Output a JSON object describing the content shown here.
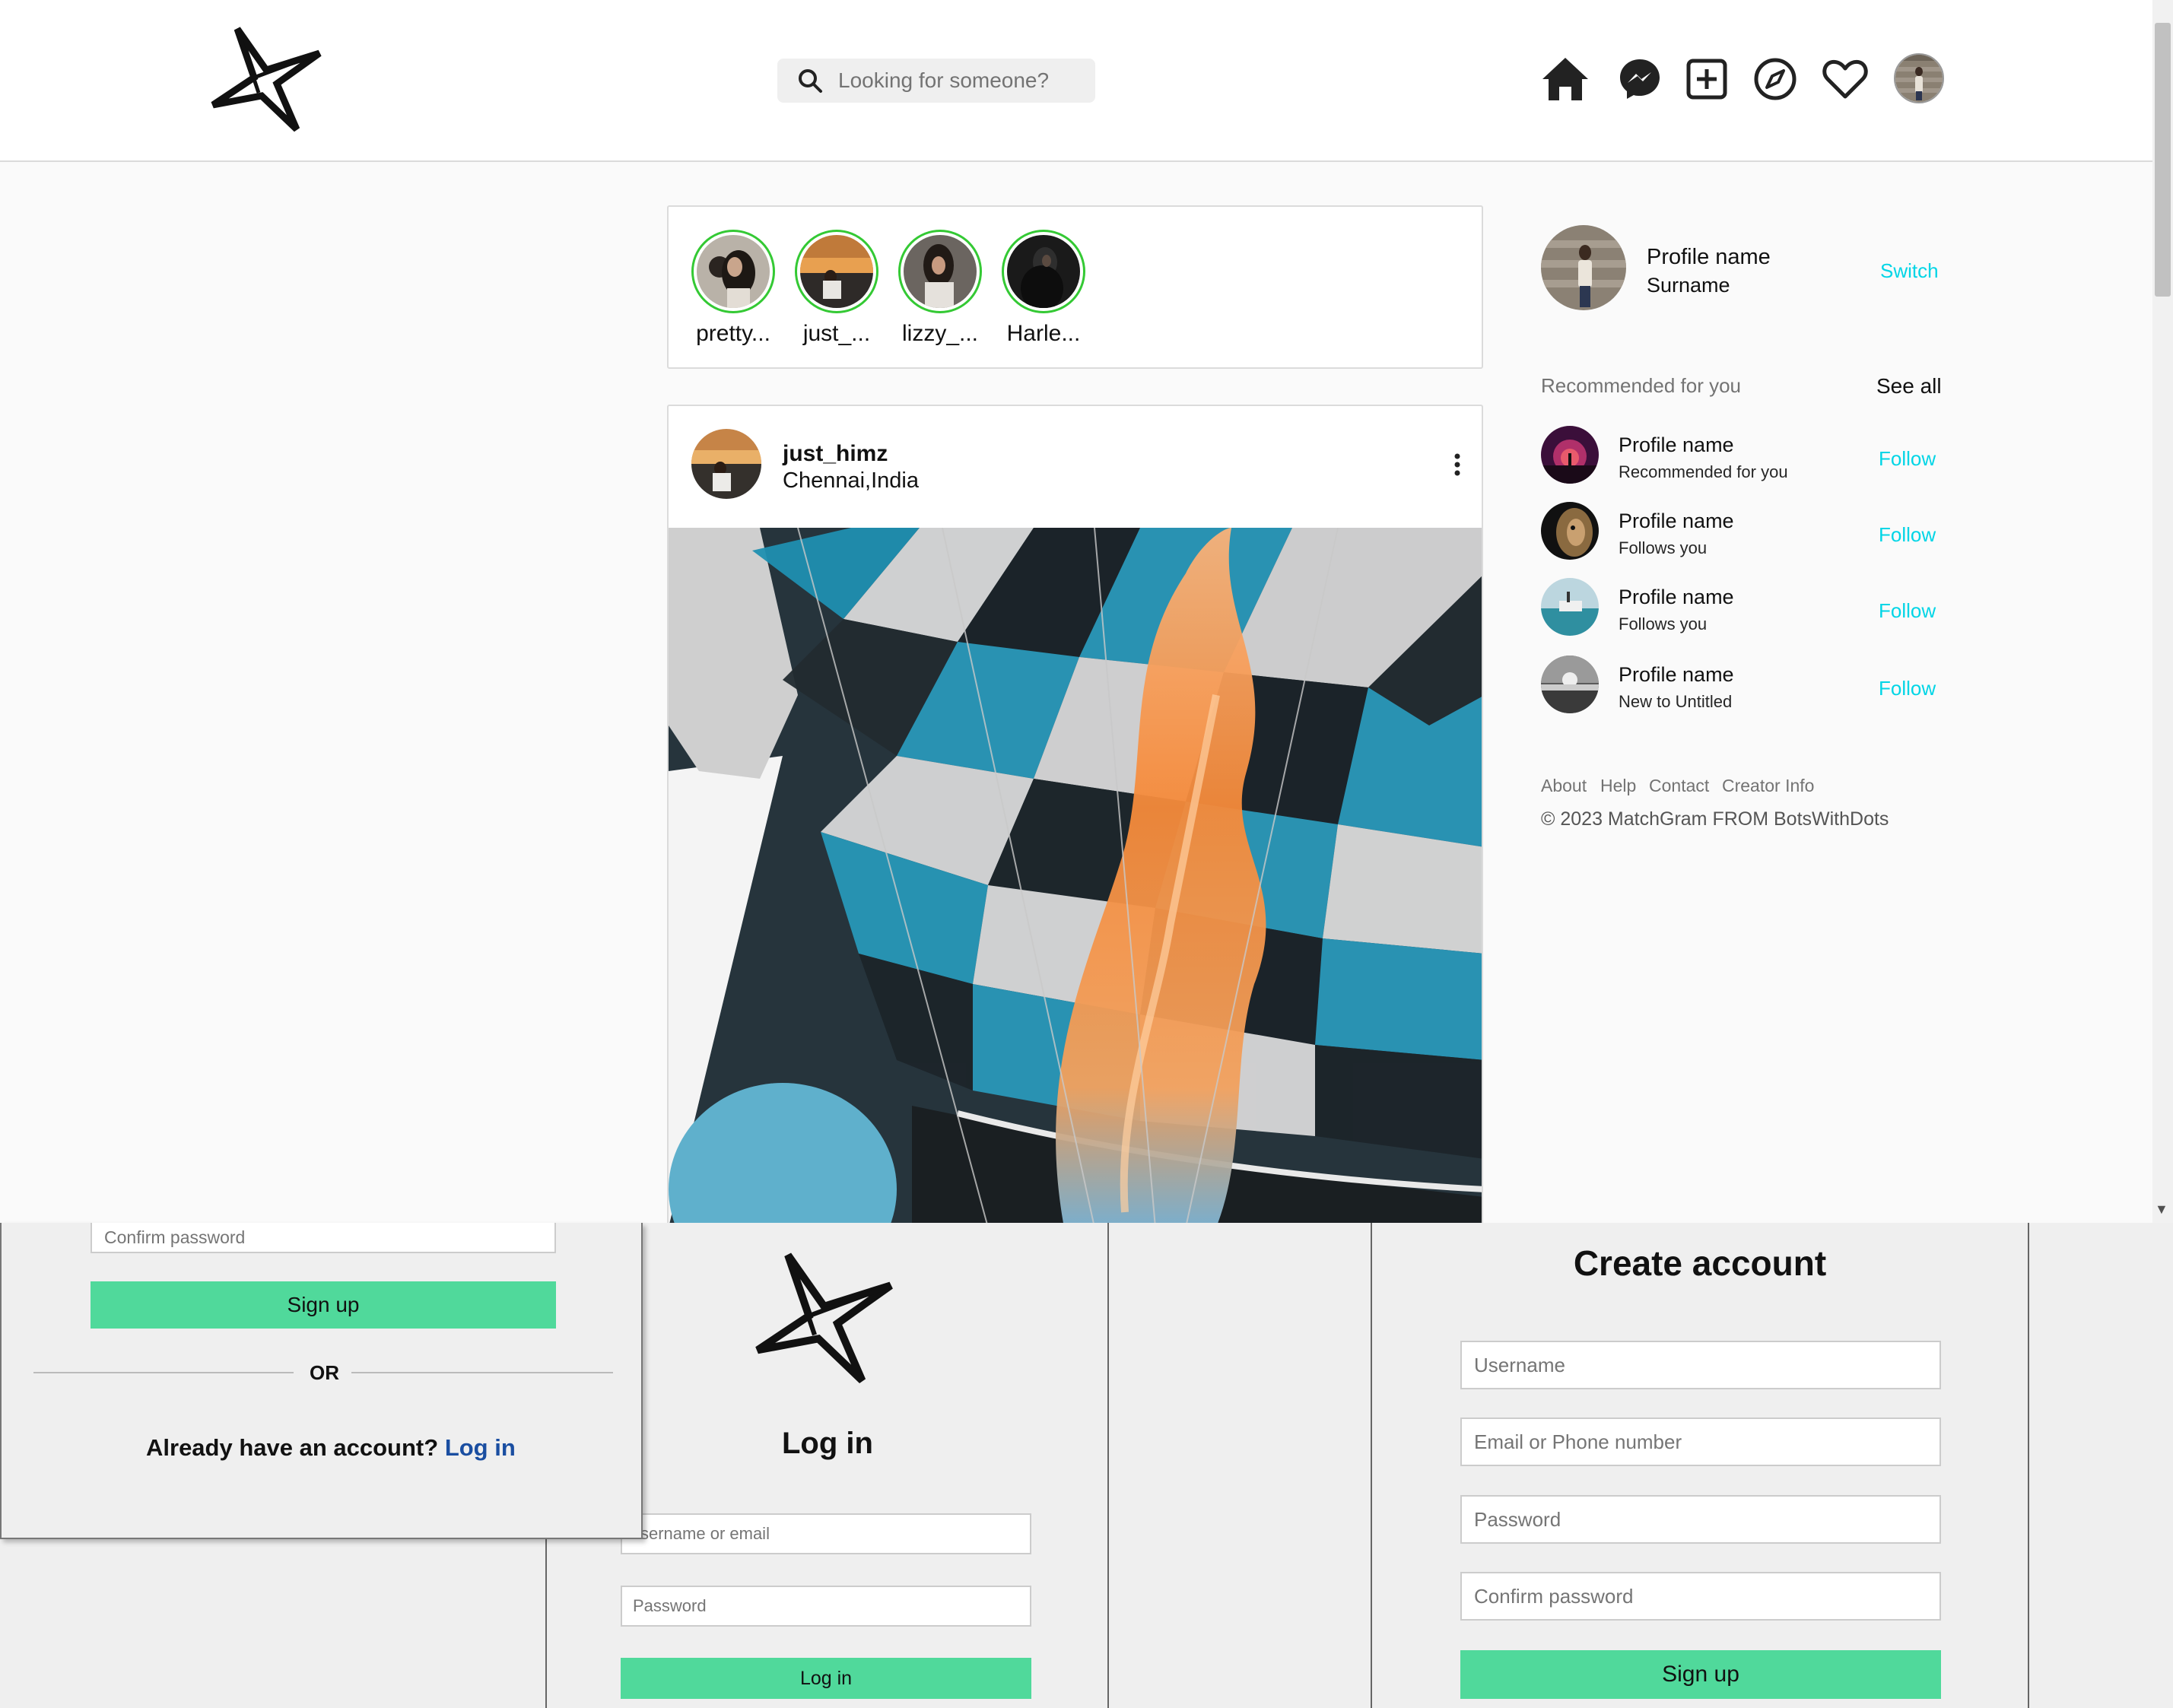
{
  "header": {
    "search_placeholder": "Looking for someone?",
    "nav_icons": [
      "home-icon",
      "messenger-icon",
      "create-post-icon",
      "explore-icon",
      "heart-icon",
      "profile-avatar"
    ]
  },
  "stories": [
    {
      "name": "pretty..."
    },
    {
      "name": "just_..."
    },
    {
      "name": "lizzy_..."
    },
    {
      "name": "Harle..."
    }
  ],
  "post": {
    "username": "just_himz",
    "location": "Chennai,India"
  },
  "sidebar": {
    "profile_name": "Profile name",
    "surname": "Surname",
    "switch_label": "Switch",
    "recommended_heading": "Recommended for you",
    "see_all": "See all",
    "suggestions": [
      {
        "name": "Profile name",
        "sub": "Recommended for you",
        "action": "Follow"
      },
      {
        "name": "Profile name",
        "sub": "Follows you",
        "action": "Follow"
      },
      {
        "name": "Profile name",
        "sub": "Follows you",
        "action": "Follow"
      },
      {
        "name": "Profile name",
        "sub": "New to Untitled",
        "action": "Follow"
      }
    ],
    "footer_links": [
      "About",
      "Help",
      "Contact",
      "Creator Info"
    ],
    "copyright": "© 2023 MatchGram FROM BotsWithDots"
  },
  "signup_left": {
    "confirm_placeholder": "Confirm password",
    "signup_button": "Sign up",
    "or_text": "OR",
    "already_text": "Already have an account? ",
    "login_link": "Log in"
  },
  "login_panel": {
    "title": "Log in",
    "username_placeholder": "sername or email",
    "password_placeholder": "Password",
    "login_button": "Log in"
  },
  "create_account": {
    "title": "Create account",
    "username_placeholder": "Username",
    "email_placeholder": "Email or Phone number",
    "password_placeholder": "Password",
    "confirm_placeholder": "Confirm password",
    "signup_button": "Sign up"
  },
  "colors": {
    "accent_button": "#50d99b",
    "follow_link": "#00d5e6",
    "story_ring": "#34c934",
    "login_link": "#1a4ea1"
  }
}
